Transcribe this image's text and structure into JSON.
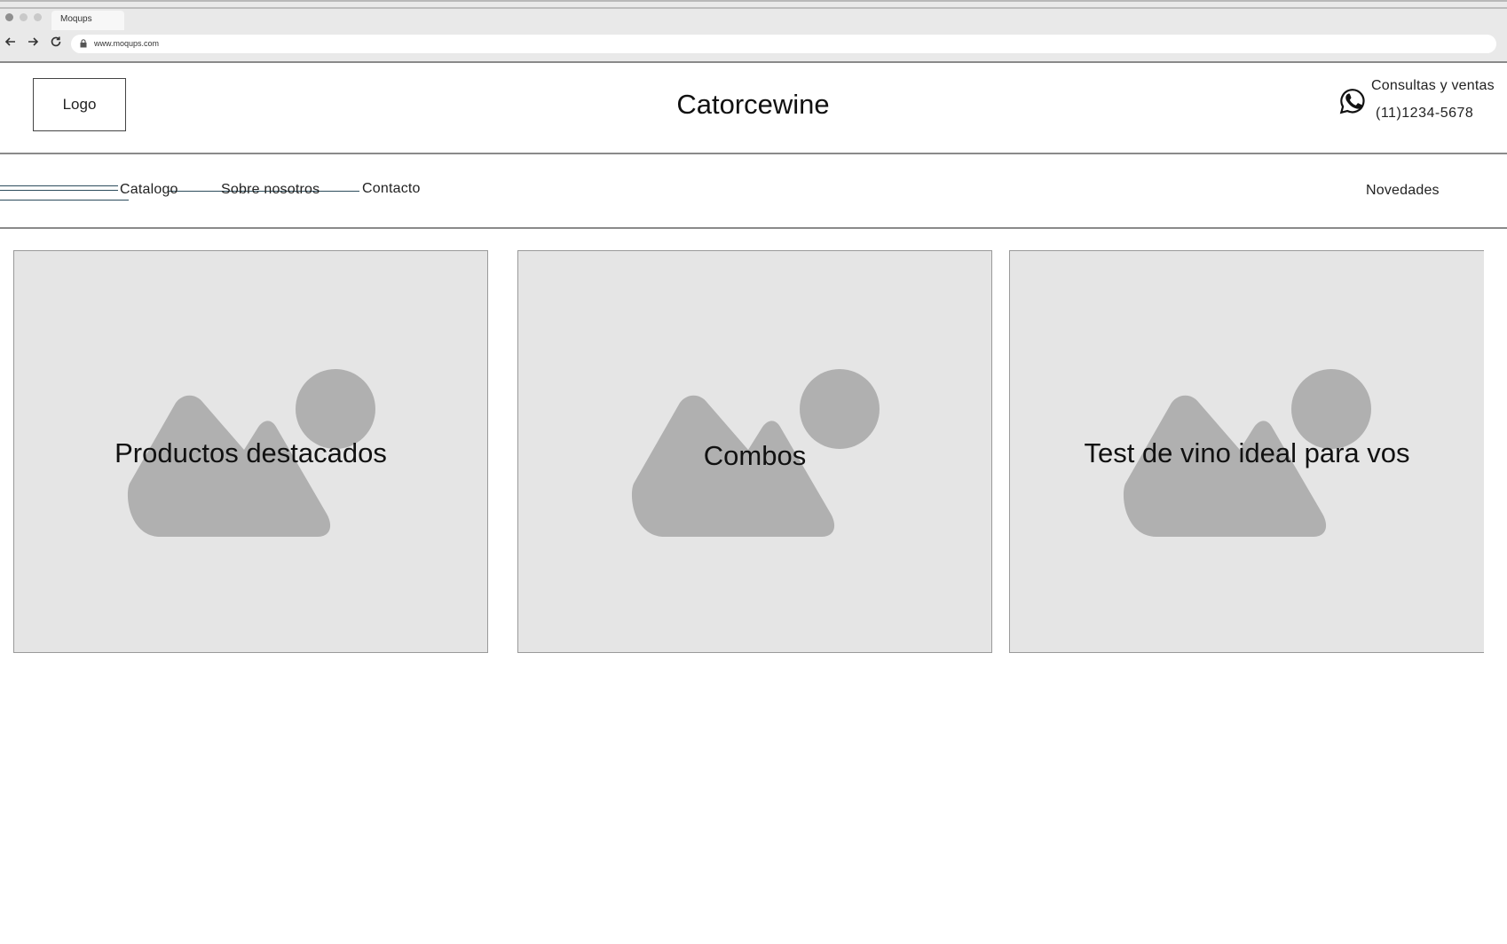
{
  "browser": {
    "tab_title": "Moqups",
    "url": "www.moqups.com"
  },
  "header": {
    "logo": "Logo",
    "site_title": "Catorcewine",
    "contact_label": "Consultas y ventas",
    "contact_phone": "(11)1234-5678",
    "contact_icon": "whatsapp-icon"
  },
  "nav": {
    "items": [
      "Catalogo",
      "Sobre nosotros",
      "Contacto"
    ],
    "right_item": "Novedades"
  },
  "cards": [
    {
      "label": "Productos destacados",
      "icon": "image-placeholder-icon"
    },
    {
      "label": "Combos",
      "icon": "image-placeholder-icon"
    },
    {
      "label": "Test de vino ideal para vos",
      "icon": "image-placeholder-icon"
    }
  ],
  "colors": {
    "card_background": "#e5e5e5",
    "placeholder_shape": "#b0b0b0",
    "nav_line": "#2c4c5c"
  }
}
